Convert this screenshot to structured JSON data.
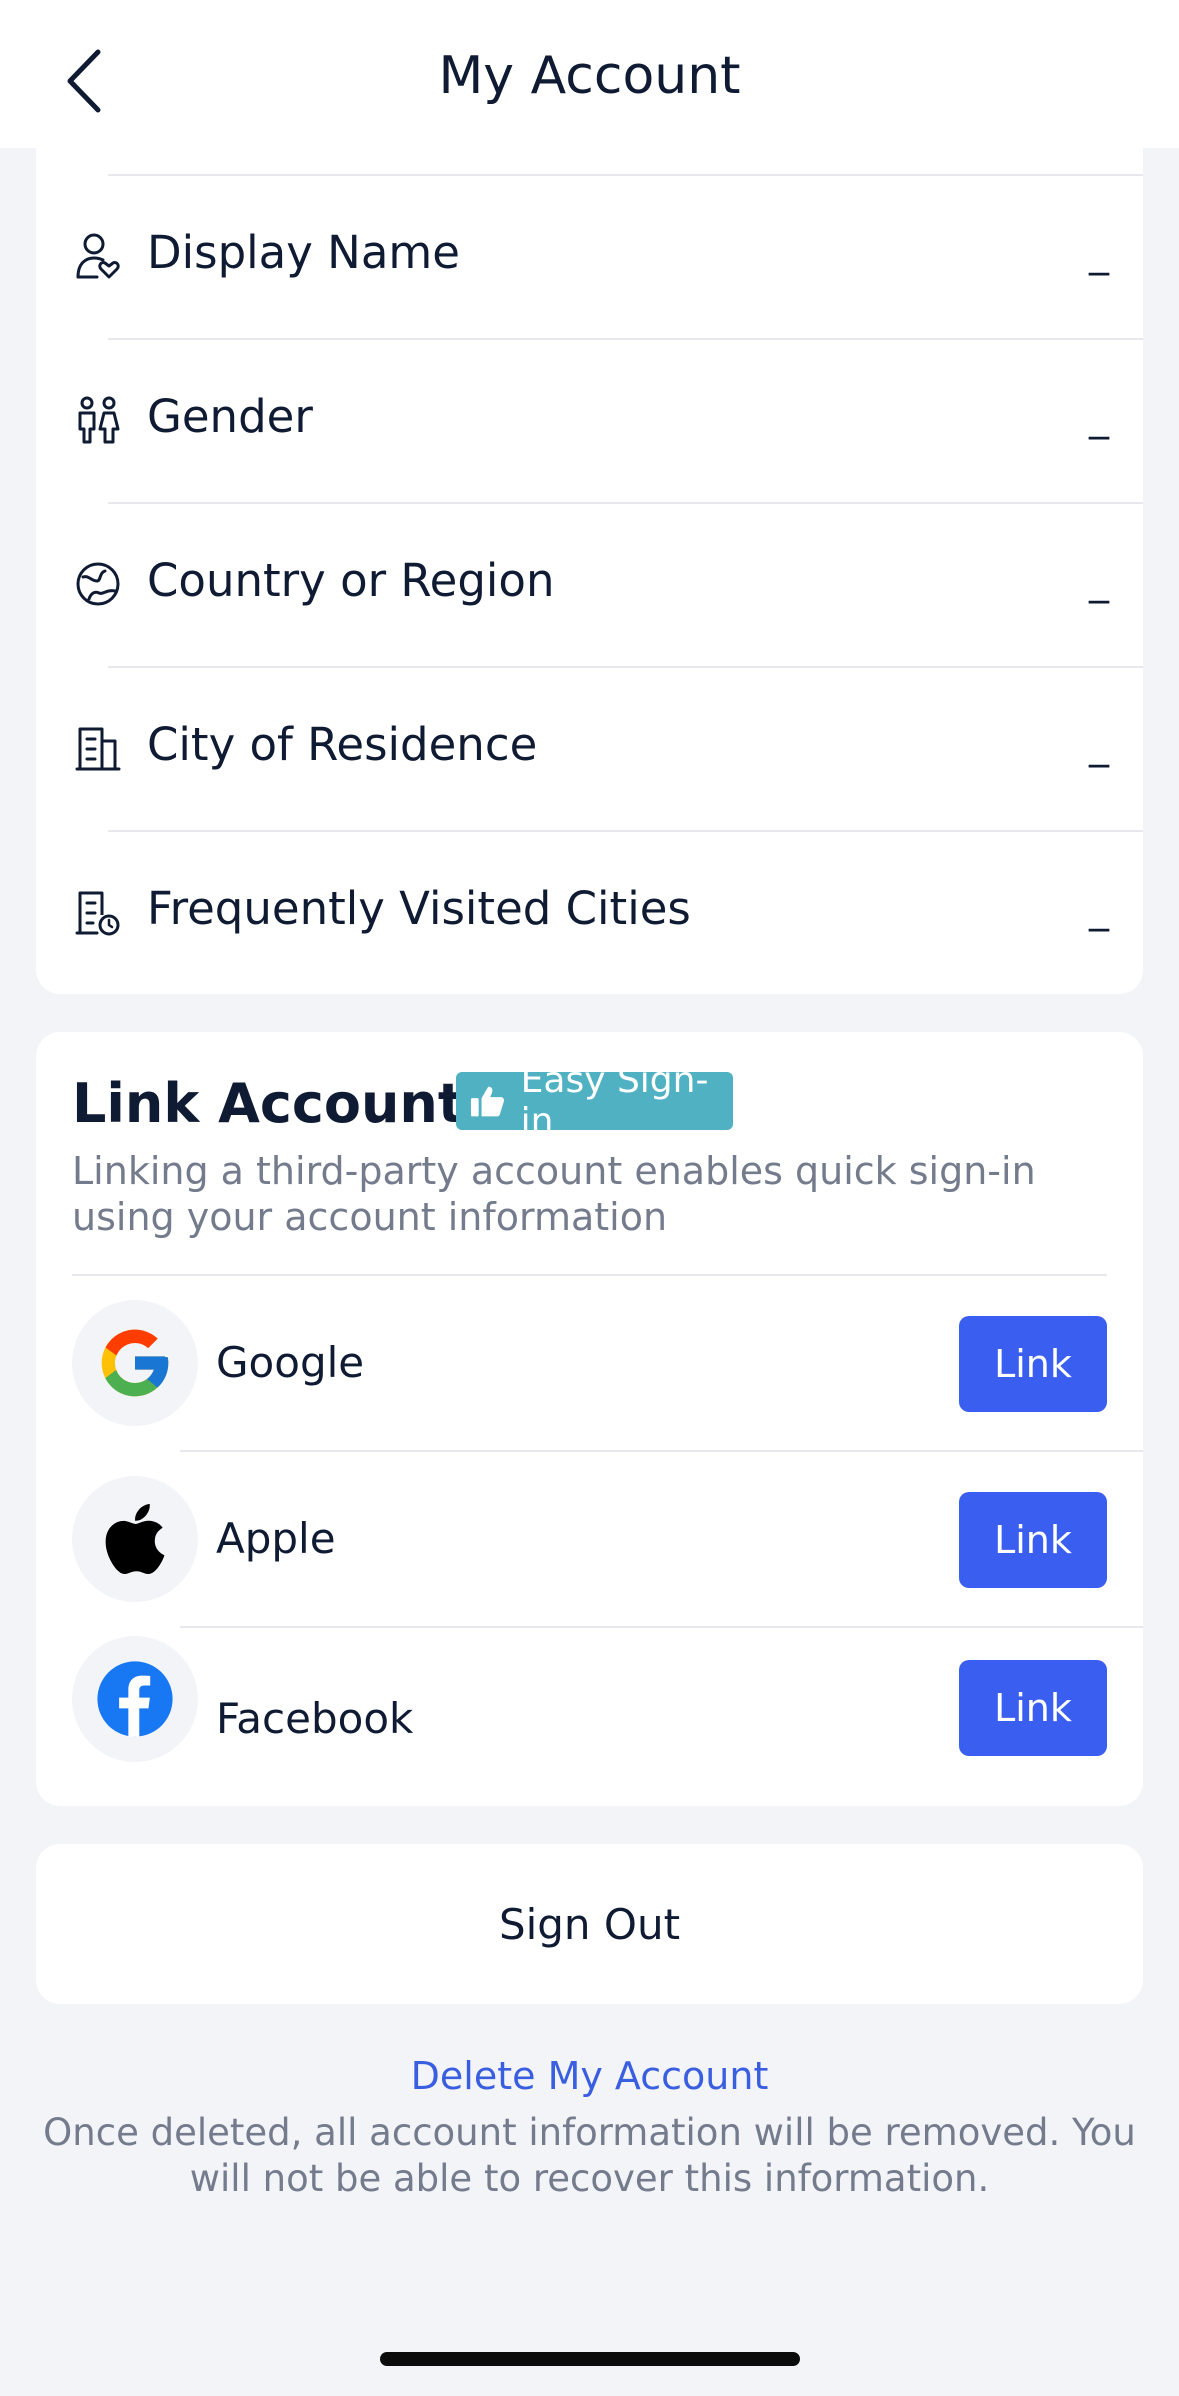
{
  "header": {
    "title": "My Account"
  },
  "profile": {
    "rows": [
      {
        "label": "Display Name",
        "value": "_",
        "icon": "user-heart-icon"
      },
      {
        "label": "Gender",
        "value": "_",
        "icon": "gender-icon"
      },
      {
        "label": "Country or Region",
        "value": "_",
        "icon": "globe-icon"
      },
      {
        "label": "City of Residence",
        "value": "_",
        "icon": "building-icon"
      },
      {
        "label": "Frequently Visited Cities",
        "value": "_",
        "icon": "building-clock-icon"
      }
    ]
  },
  "link_accounts": {
    "title": "Link Accounts",
    "badge": "Easy Sign-in",
    "description": "Linking a third-party account enables quick sign-in using your account information",
    "providers": [
      {
        "name": "Google",
        "button": "Link"
      },
      {
        "name": "Apple",
        "button": "Link"
      },
      {
        "name": "Facebook",
        "button": "Link"
      }
    ]
  },
  "sign_out": "Sign Out",
  "delete": {
    "link": "Delete My Account",
    "note": "Once deleted, all account information will be removed. You will not be able to recover this information."
  },
  "colors": {
    "accent": "#3a5ef0",
    "badge": "#4fb1c2",
    "background": "#f3f4f8",
    "text": "#0f1a33"
  }
}
